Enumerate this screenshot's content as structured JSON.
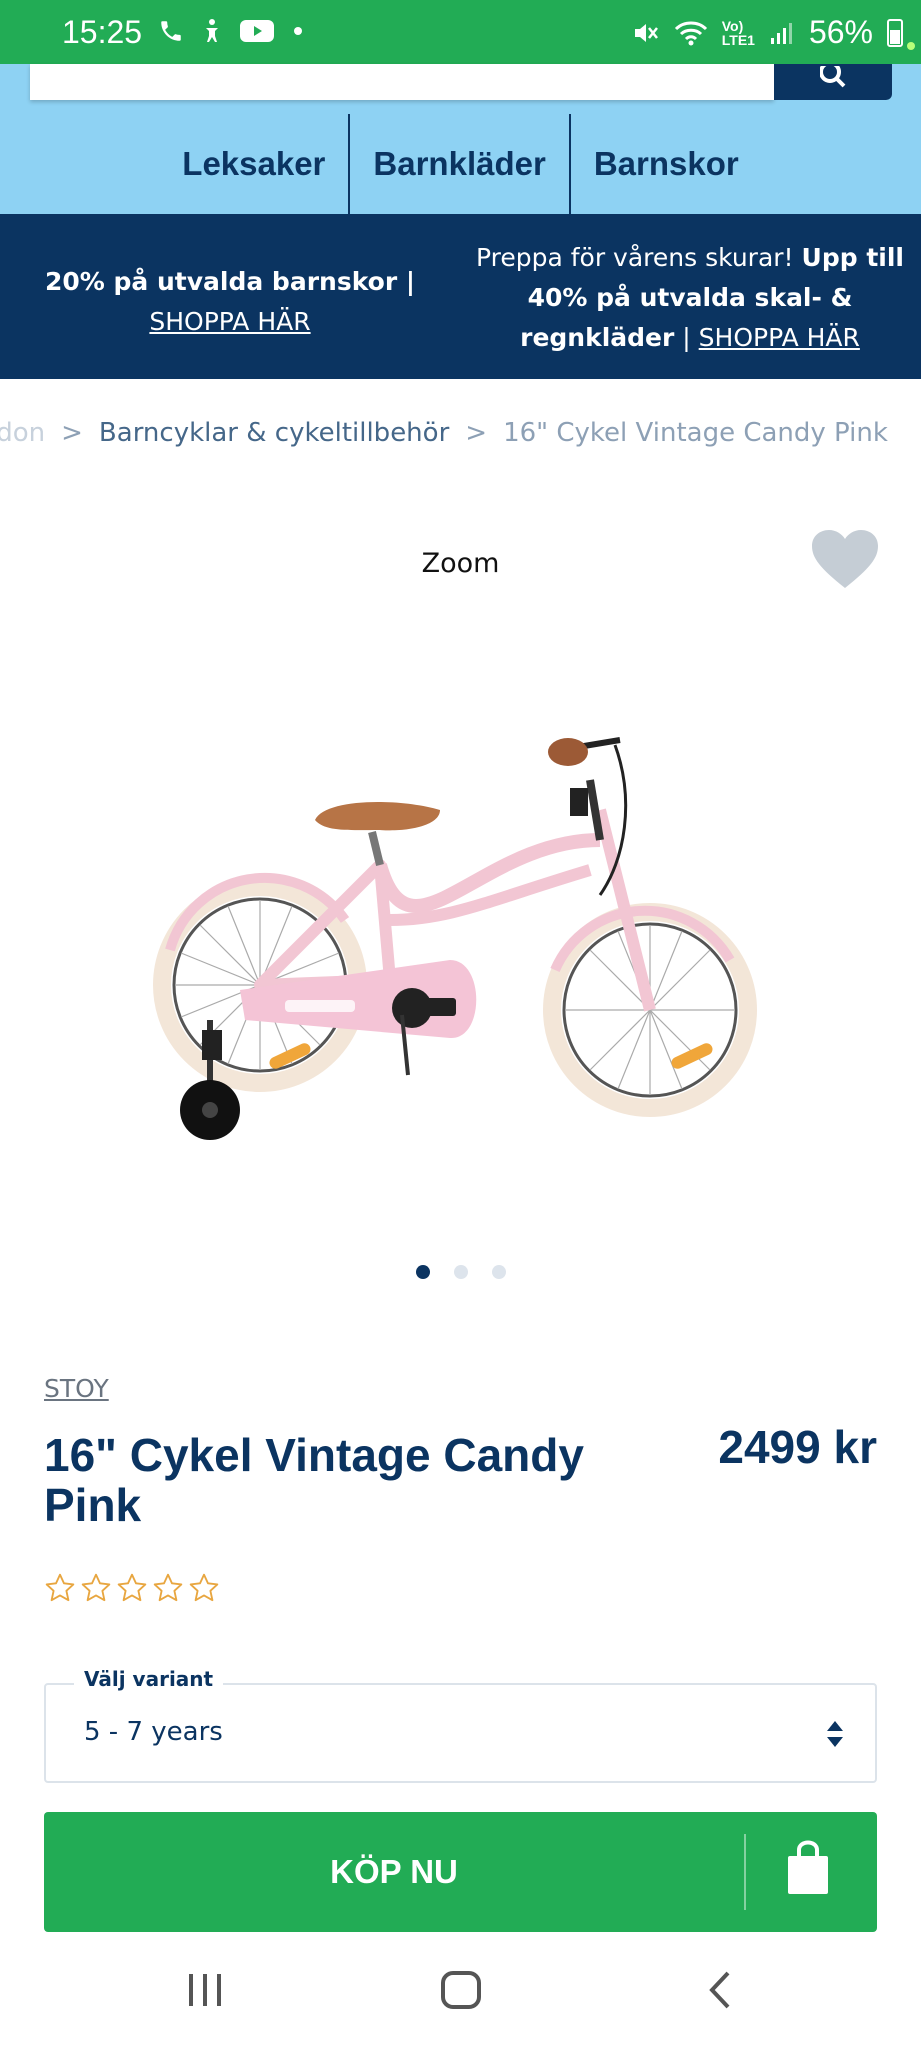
{
  "status_bar": {
    "time": "15:25",
    "network": "Vo)\nLTE1",
    "battery": "56%"
  },
  "categories": [
    "Leksaker",
    "Barnkläder",
    "Barnskor"
  ],
  "promo": {
    "left_text": "20% på utvalda barnskor |",
    "left_link": "SHOPPA HÄR",
    "right_text_a": "Preppa för vårens skurar! ",
    "right_text_b": "Upp till 40% på utvalda skal- & regnkläder",
    "right_sep": " | ",
    "right_link": "SHOPPA HÄR"
  },
  "breadcrumb": {
    "faded": "rdon",
    "sep1": ">",
    "link": "Barncyklar & cykeltillbehör",
    "sep2": ">",
    "current": "16\" Cykel Vintage Candy Pink"
  },
  "gallery": {
    "zoom_label": "Zoom",
    "slide_count": 3,
    "active_slide": 1
  },
  "product": {
    "brand": "STOY",
    "title": "16\" Cykel Vintage Candy Pink",
    "price": "2499 kr",
    "rating": 0,
    "rating_max": 5
  },
  "variant": {
    "label": "Välj variant",
    "value": "5 - 7 years"
  },
  "buy_button": {
    "label": "KÖP NU"
  },
  "colors": {
    "status_bar": "#22ac55",
    "header": "#8ed2f3",
    "navy": "#0b3461",
    "buy": "#22ac55",
    "star": "#e8a640"
  }
}
